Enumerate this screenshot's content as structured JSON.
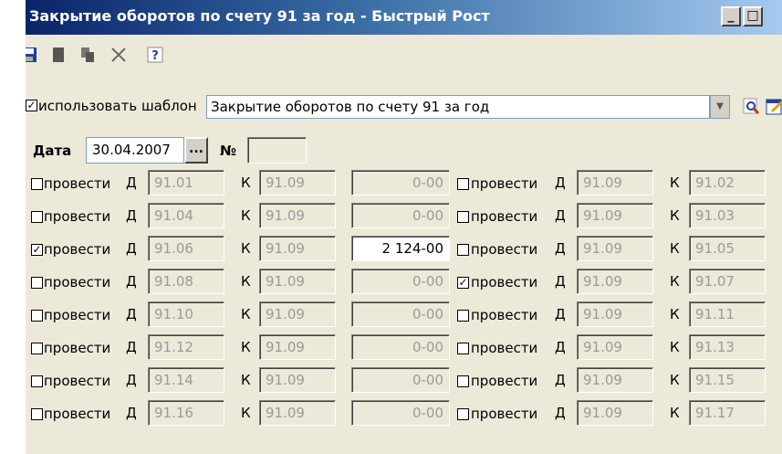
{
  "window": {
    "title": "Закрытие оборотов по счету 91 за год - Быстрый Рост",
    "minimize": "_",
    "maximize": "□"
  },
  "toolbar": {
    "icons": [
      "save-icon",
      "new-document-icon",
      "copy-icon",
      "delete-icon",
      "help-icon"
    ]
  },
  "template": {
    "checkbox_label": "использовать шаблон",
    "checked": true,
    "selected": "Закрытие оборотов по счету 91 за год"
  },
  "header": {
    "date_label": "Дата",
    "date_value": "30.04.2007",
    "dots_label": "...",
    "number_label": "№",
    "number_value": ""
  },
  "labels": {
    "post": "провести",
    "debit": "Д",
    "credit": "К"
  },
  "rows": [
    {
      "left": {
        "checked": false,
        "d": "91.01",
        "k": "91.09",
        "amount": "0-00"
      },
      "right": {
        "checked": false,
        "d": "91.09",
        "k": "91.02"
      }
    },
    {
      "left": {
        "checked": false,
        "d": "91.04",
        "k": "91.09",
        "amount": "0-00"
      },
      "right": {
        "checked": false,
        "d": "91.09",
        "k": "91.03"
      }
    },
    {
      "left": {
        "checked": true,
        "d": "91.06",
        "k": "91.09",
        "amount": "2 124-00"
      },
      "right": {
        "checked": false,
        "d": "91.09",
        "k": "91.05"
      }
    },
    {
      "left": {
        "checked": false,
        "d": "91.08",
        "k": "91.09",
        "amount": "0-00"
      },
      "right": {
        "checked": true,
        "d": "91.09",
        "k": "91.07"
      }
    },
    {
      "left": {
        "checked": false,
        "d": "91.10",
        "k": "91.09",
        "amount": "0-00"
      },
      "right": {
        "checked": false,
        "d": "91.09",
        "k": "91.11"
      }
    },
    {
      "left": {
        "checked": false,
        "d": "91.12",
        "k": "91.09",
        "amount": "0-00"
      },
      "right": {
        "checked": false,
        "d": "91.09",
        "k": "91.13"
      }
    },
    {
      "left": {
        "checked": false,
        "d": "91.14",
        "k": "91.09",
        "amount": "0-00"
      },
      "right": {
        "checked": false,
        "d": "91.09",
        "k": "91.15"
      }
    },
    {
      "left": {
        "checked": false,
        "d": "91.16",
        "k": "91.09",
        "amount": "0-00"
      },
      "right": {
        "checked": false,
        "d": "91.09",
        "k": "91.17"
      }
    }
  ]
}
